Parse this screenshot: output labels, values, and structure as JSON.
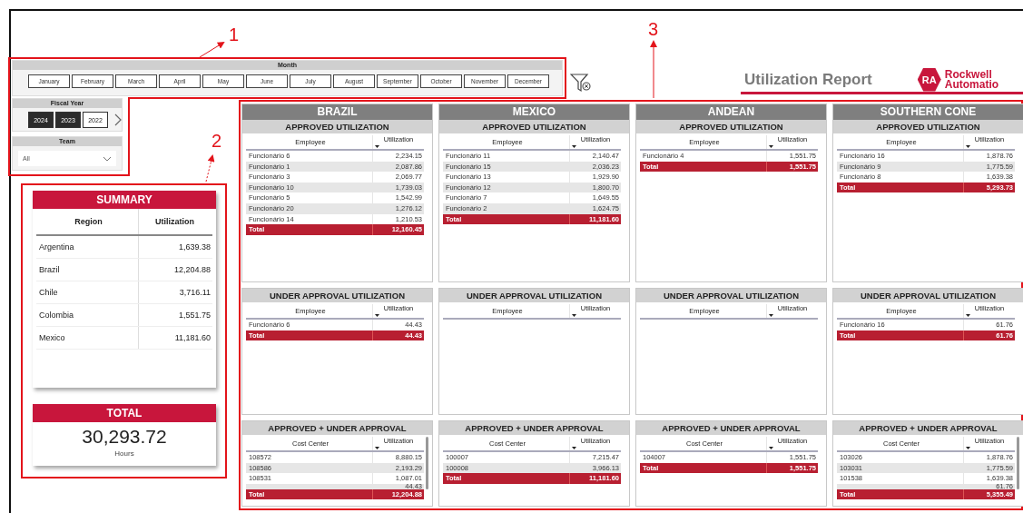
{
  "annotations": [
    {
      "label": "1"
    },
    {
      "label": "2"
    },
    {
      "label": "3"
    }
  ],
  "month_slicer": {
    "title": "Month",
    "months": [
      {
        "label": "January",
        "selected": false
      },
      {
        "label": "February",
        "selected": false
      },
      {
        "label": "March",
        "selected": false
      },
      {
        "label": "April",
        "selected": false
      },
      {
        "label": "May",
        "selected": false
      },
      {
        "label": "June",
        "selected": false
      },
      {
        "label": "July",
        "selected": false
      },
      {
        "label": "August",
        "selected": false
      },
      {
        "label": "September",
        "selected": false
      },
      {
        "label": "October",
        "selected": false
      },
      {
        "label": "November",
        "selected": false
      },
      {
        "label": "December",
        "selected": false
      }
    ]
  },
  "header": {
    "title": "Utilization Report",
    "logo_badge": "RA",
    "logo_lines": [
      "Rockwell",
      "Automatio"
    ]
  },
  "fiscal_year": {
    "title": "Fiscal Year",
    "years": [
      {
        "label": "2024",
        "selected": true
      },
      {
        "label": "2023",
        "selected": true
      },
      {
        "label": "2022",
        "selected": false
      }
    ]
  },
  "team": {
    "title": "Team",
    "value": "All"
  },
  "summary": {
    "title": "SUMMARY",
    "columns": [
      "Region",
      "Utilization"
    ],
    "rows": [
      {
        "name": "Argentina",
        "value": "1,639.38"
      },
      {
        "name": "Brazil",
        "value": "12,204.88"
      },
      {
        "name": "Chile",
        "value": "3,716.11"
      },
      {
        "name": "Colombia",
        "value": "1,551.75"
      },
      {
        "name": "Mexico",
        "value": "11,181.60"
      }
    ]
  },
  "total": {
    "title": "TOTAL",
    "value": "30,293.72",
    "unit": "Hours"
  },
  "regions": [
    {
      "name": "BRAZIL",
      "panels": [
        {
          "title": "APPROVED UTILIZATION",
          "columns": [
            "Employee",
            "Utilization"
          ],
          "scrollable": false,
          "rows": [
            {
              "name": "Funcionário 6",
              "value": "2,234.15"
            },
            {
              "name": "Funcionário 1",
              "value": "2,087.86"
            },
            {
              "name": "Funcionário 3",
              "value": "2,069.77"
            },
            {
              "name": "Funcionário 10",
              "value": "1,739.03"
            },
            {
              "name": "Funcionário 5",
              "value": "1,542.99"
            },
            {
              "name": "Funcionário 20",
              "value": "1,276.12"
            },
            {
              "name": "Funcionário 14",
              "value": "1,210.53"
            }
          ],
          "total": {
            "name": "Total",
            "value": "12,160.45"
          }
        },
        {
          "title": "UNDER APPROVAL UTILIZATION",
          "columns": [
            "Employee",
            "Utilization"
          ],
          "scrollable": false,
          "rows": [
            {
              "name": "Funcionário 6",
              "value": "44.43"
            }
          ],
          "total": {
            "name": "Total",
            "value": "44.43"
          }
        },
        {
          "title": "APPROVED + UNDER APPROVAL",
          "columns": [
            "Cost Center",
            "Utilization"
          ],
          "scrollable": true,
          "rows": [
            {
              "name": "108572",
              "value": "8,880.15"
            },
            {
              "name": "108586",
              "value": "2,193.29"
            },
            {
              "name": "108531",
              "value": "1,087.01"
            },
            {
              "value": "44.43"
            }
          ],
          "total": {
            "name": "Total",
            "value": "12,204.88"
          }
        }
      ]
    },
    {
      "name": "MEXICO",
      "panels": [
        {
          "title": "APPROVED UTILIZATION",
          "columns": [
            "Employee",
            "Utilization"
          ],
          "scrollable": false,
          "rows": [
            {
              "name": "Funcionário 11",
              "value": "2,140.47"
            },
            {
              "name": "Funcionário 15",
              "value": "2,036.23"
            },
            {
              "name": "Funcionário 13",
              "value": "1,929.90"
            },
            {
              "name": "Funcionário 12",
              "value": "1,800.70"
            },
            {
              "name": "Funcionário 7",
              "value": "1,649.55"
            },
            {
              "name": "Funcionário 2",
              "value": "1,624.75"
            }
          ],
          "total": {
            "name": "Total",
            "value": "11,181.60"
          }
        },
        {
          "title": "UNDER APPROVAL UTILIZATION",
          "columns": [
            "Employee",
            "Utilization"
          ],
          "scrollable": false
        },
        {
          "title": "APPROVED + UNDER APPROVAL",
          "columns": [
            "Cost Center",
            "Utilization"
          ],
          "scrollable": false,
          "rows": [
            {
              "name": "100007",
              "value": "7,215.47"
            },
            {
              "name": "100008",
              "value": "3,966.13"
            }
          ],
          "total": {
            "name": "Total",
            "value": "11,181.60"
          }
        }
      ]
    },
    {
      "name": "ANDEAN",
      "panels": [
        {
          "title": "APPROVED UTILIZATION",
          "columns": [
            "Employee",
            "Utilization"
          ],
          "scrollable": false,
          "rows": [
            {
              "name": "Funcionário 4",
              "value": "1,551.75"
            }
          ],
          "total": {
            "name": "Total",
            "value": "1,551.75"
          }
        },
        {
          "title": "UNDER APPROVAL UTILIZATION",
          "columns": [
            "Employee",
            "Utilization"
          ],
          "scrollable": false
        },
        {
          "title": "APPROVED + UNDER APPROVAL",
          "columns": [
            "Cost Center",
            "Utilization"
          ],
          "scrollable": false,
          "rows": [
            {
              "name": "104007",
              "value": "1,551.75"
            }
          ],
          "total": {
            "name": "Total",
            "value": "1,551.75"
          }
        }
      ]
    },
    {
      "name": "SOUTHERN CONE",
      "panels": [
        {
          "title": "APPROVED UTILIZATION",
          "columns": [
            "Employee",
            "Utilization"
          ],
          "scrollable": false,
          "rows": [
            {
              "name": "Funcionário 16",
              "value": "1,878.76"
            },
            {
              "name": "Funcionário 9",
              "value": "1,775.59"
            },
            {
              "name": "Funcionário 8",
              "value": "1,639.38"
            }
          ],
          "total": {
            "name": "Total",
            "value": "5,293.73"
          }
        },
        {
          "title": "UNDER APPROVAL UTILIZATION",
          "columns": [
            "Employee",
            "Utilization"
          ],
          "scrollable": false,
          "rows": [
            {
              "name": "Funcionário 16",
              "value": "61.76"
            }
          ],
          "total": {
            "name": "Total",
            "value": "61.76"
          }
        },
        {
          "title": "APPROVED + UNDER APPROVAL",
          "columns": [
            "Cost Center",
            "Utilization"
          ],
          "scrollable": true,
          "rows": [
            {
              "name": "103026",
              "value": "1,878.76"
            },
            {
              "name": "103031",
              "value": "1,775.59"
            },
            {
              "name": "101538",
              "value": "1,639.38"
            },
            {
              "value": "61.76"
            }
          ],
          "total": {
            "name": "Total",
            "value": "5,355.49"
          }
        }
      ]
    }
  ]
}
